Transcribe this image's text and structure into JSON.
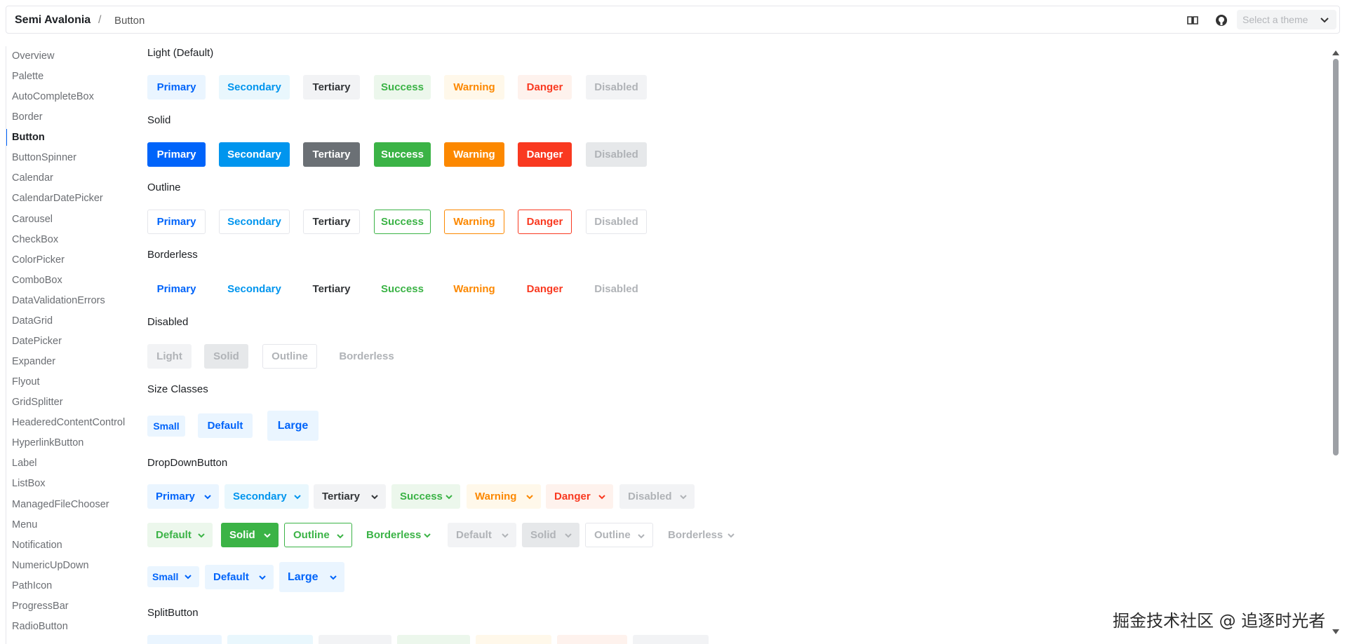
{
  "header": {
    "brand": "Semi Avalonia",
    "separator": "/",
    "breadcrumb": "Button",
    "theme_placeholder": "Select a theme"
  },
  "sidebar": {
    "items": [
      "Overview",
      "Palette",
      "AutoCompleteBox",
      "Border",
      "Button",
      "ButtonSpinner",
      "Calendar",
      "CalendarDatePicker",
      "Carousel",
      "CheckBox",
      "ColorPicker",
      "ComboBox",
      "DataValidationErrors",
      "DataGrid",
      "DatePicker",
      "Expander",
      "Flyout",
      "GridSplitter",
      "HeaderedContentControl",
      "HyperlinkButton",
      "Label",
      "ListBox",
      "ManagedFileChooser",
      "Menu",
      "Notification",
      "NumericUpDown",
      "PathIcon",
      "ProgressBar",
      "RadioButton"
    ],
    "active": "Button"
  },
  "sections": {
    "light": "Light (Default)",
    "solid": "Solid",
    "outline": "Outline",
    "borderless": "Borderless",
    "disabled": "Disabled",
    "size": "Size Classes",
    "dropdown": "DropDownButton",
    "split": "SplitButton"
  },
  "button_labels": [
    "Primary",
    "Secondary",
    "Tertiary",
    "Success",
    "Warning",
    "Danger",
    "Disabled"
  ],
  "disabled_labels": [
    "Light",
    "Solid",
    "Outline",
    "Borderless"
  ],
  "size_labels": [
    "Small",
    "Default",
    "Large"
  ],
  "dropdown_row1": [
    "Primary",
    "Secondary",
    "Tertiary",
    "Success",
    "Warning",
    "Danger",
    "Disabled"
  ],
  "dropdown_row2": [
    "Default",
    "Solid",
    "Outline",
    "Borderless",
    "Default",
    "Solid",
    "Outline",
    "Borderless"
  ],
  "dropdown_row3": [
    "Small",
    "Default",
    "Large"
  ],
  "colors": {
    "primary": "#0064fa",
    "secondary": "#0095ee",
    "tertiary": "#6b7075",
    "success": "#3bb346",
    "warning": "#fc8800",
    "danger": "#f93920",
    "disabled": "#c6cacd"
  },
  "watermark": "掘金技术社区 @ 追逐时光者"
}
